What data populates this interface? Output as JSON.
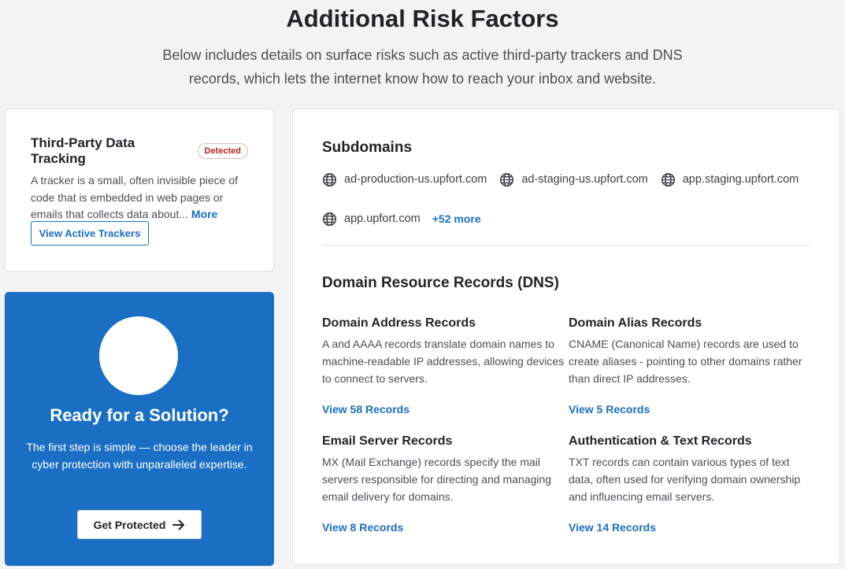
{
  "header": {
    "title": "Additional Risk Factors",
    "subtitle": "Below includes details on surface risks such as active third-party trackers and DNS records, which lets the internet know how to reach your inbox and website."
  },
  "tracking": {
    "title": "Third-Party Data Tracking",
    "badge": "Detected",
    "description": "A tracker is a small, often invisible piece of code that is embedded in web pages or emails that collects data about...",
    "more_label": "More",
    "button_label": "View Active Trackers"
  },
  "solution": {
    "title": "Ready for a Solution?",
    "description": "The first step is simple — choose the leader in cyber protection with unparalleled expertise.",
    "button_label": "Get Protected"
  },
  "subdomains": {
    "title": "Subdomains",
    "items": [
      {
        "label": "ad-production-us.upfort.com",
        "icon": "globe-icon"
      },
      {
        "label": "ad-staging-us.upfort.com",
        "icon": "globe-icon"
      },
      {
        "label": "app.staging.upfort.com",
        "icon": "globe-icon"
      },
      {
        "label": "app.upfort.com",
        "icon": "globe-icon"
      }
    ],
    "more_label": "+52 more"
  },
  "dns": {
    "title": "Domain Resource Records (DNS)",
    "records": [
      {
        "title": "Domain Address Records",
        "description": "A and AAAA records translate domain names to machine-readable IP addresses, allowing devices to connect to servers.",
        "link": "View 58 Records"
      },
      {
        "title": "Domain Alias Records",
        "description": "CNAME (Canonical Name) records are used to create aliases - pointing to other domains rather than direct IP addresses.",
        "link": "View 5 Records"
      },
      {
        "title": "Email Server Records",
        "description": "MX (Mail Exchange) records specify the mail servers responsible for directing and managing email delivery for domains.",
        "link": "View 8 Records"
      },
      {
        "title": "Authentication & Text Records",
        "description": "TXT records can contain various types of text data, often used for verifying domain ownership and influencing email servers.",
        "link": "View 14 Records"
      }
    ]
  },
  "colors": {
    "accent": "#1a6fc4",
    "badge_red": "#b3261e",
    "background": "#f2f3f5"
  }
}
